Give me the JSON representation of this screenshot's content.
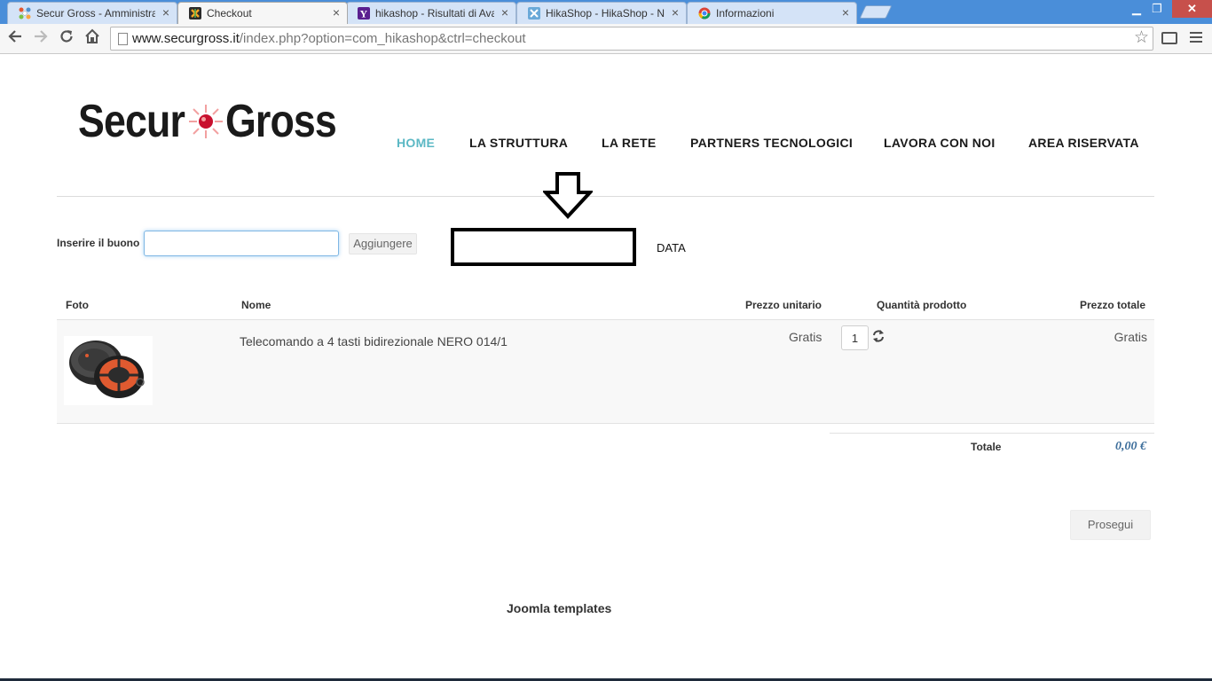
{
  "browser": {
    "tabs": [
      {
        "title": "Secur Gross - Amministraz",
        "favicon": "joomla-icon"
      },
      {
        "title": "Checkout",
        "favicon": "hikashop-icon",
        "active": true
      },
      {
        "title": "hikashop - Risultati di Ava",
        "favicon": "yahoo-icon"
      },
      {
        "title": "HikaShop - HikaShop - Ne",
        "favicon": "hikashop-icon"
      },
      {
        "title": "Informazioni",
        "favicon": "chrome-icon"
      }
    ],
    "url_host": "www.securgross.it",
    "url_path": "/index.php?option=com_hikashop&ctrl=checkout"
  },
  "site": {
    "logo_left": "Secur",
    "logo_right": "Gross",
    "nav": [
      "HOME",
      "LA STRUTTURA",
      "LA RETE",
      "PARTNERS TECNOLOGICI",
      "LAVORA CON NOI",
      "AREA RISERVATA"
    ],
    "active_nav": "HOME"
  },
  "annotation": {
    "text": "DATA"
  },
  "coupon": {
    "label": "Inserire il buono",
    "value": "",
    "button": "Aggiungere"
  },
  "cart": {
    "headers": {
      "photo": "Foto",
      "name": "Nome",
      "unit_price": "Prezzo unitario",
      "quantity": "Quantità prodotto",
      "total_price": "Prezzo totale"
    },
    "items": [
      {
        "name": "Telecomando a 4 tasti bidirezionale NERO 014/1",
        "unit_price": "Gratis",
        "quantity": "1",
        "total": "Gratis"
      }
    ],
    "total_label": "Totale",
    "total_value": "0,00 €"
  },
  "proceed_button": "Prosegui",
  "footer_link": "Joomla templates",
  "colors": {
    "nav_active": "#5bb8c4",
    "total_value": "#3d6e9b",
    "tabstrip": "#4a8ed9"
  }
}
